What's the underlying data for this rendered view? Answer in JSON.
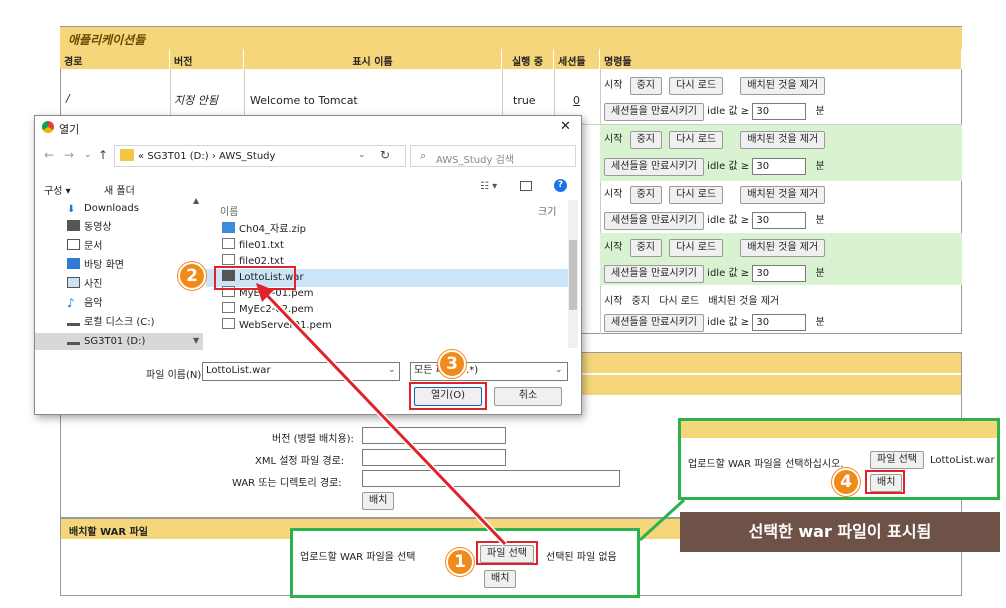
{
  "manager": {
    "applications_title": "애플리케이션들",
    "columns": [
      "경로",
      "버전",
      "표시 이름",
      "실행 중",
      "세션들",
      "명령들"
    ],
    "row1": {
      "path": "/",
      "version": "지정 안됨",
      "display_name": "Welcome to Tomcat",
      "running": "true",
      "sessions": "0"
    },
    "cmd": {
      "start": "시작",
      "stop": "중지",
      "reload": "다시 로드",
      "undeploy": "배치된 것을 제거",
      "expire": "세션들을 만료시키기",
      "idle": "idle 값 ≥",
      "idle_value": "30",
      "minutes": "분"
    },
    "deploy": {
      "version_label": "버전 (병렬 배치용):",
      "xml_label": "XML 설정 파일 경로:",
      "war_dir_label": "WAR 또는 디렉토리 경로:",
      "deploy_button": "배치"
    },
    "war_section": {
      "title": "배치할 WAR 파일",
      "prompt": "업로드할 WAR 파일을 선택하십시오.",
      "prompt_short": "업로드할 WAR 파일을 선택",
      "choose_button": "파일 선택",
      "no_file": "선택된 파일 없음",
      "deploy_button": "배치"
    }
  },
  "dialog": {
    "title": "열기",
    "breadcrumb": [
      "SG3T01 (D:)",
      "AWS_Study"
    ],
    "breadcrumb_prefix": "«",
    "search_placeholder": "AWS_Study 검색",
    "organize": "구성 ▾",
    "new_folder": "새 폴더",
    "column_name": "이름",
    "column_size": "크기",
    "tree": [
      "Downloads",
      "동영상",
      "문서",
      "바탕 화면",
      "사진",
      "음악",
      "로컬 디스크 (C:)",
      "SG3T01 (D:)"
    ],
    "files": [
      "Ch04_자료.zip",
      "file01.txt",
      "file02.txt",
      "LottoList.war",
      "MyEc2-01.pem",
      "MyEc2-02.pem",
      "WebServer01.pem"
    ],
    "filename_label": "파일 이름(N):",
    "filename_value": "LottoList.war",
    "filetype_value": "모든 파일 (*.*)",
    "open_button": "열기(O)",
    "cancel_button": "취소",
    "close_glyph": "✕"
  },
  "callout": {
    "prompt": "업로드할 WAR 파일을 선택하십시오.",
    "choose_button": "파일 선택",
    "filename": "LottoList.war",
    "deploy_button": "배치",
    "caption": "선택한 war 파일이 표시됨"
  },
  "steps": [
    "1",
    "2",
    "3",
    "4"
  ],
  "colors": {
    "header": "#f5d67a",
    "green_row": "#d9f2d0",
    "callout_border": "#2bb24c",
    "step": "#f08a1a",
    "red": "#e0222a"
  }
}
